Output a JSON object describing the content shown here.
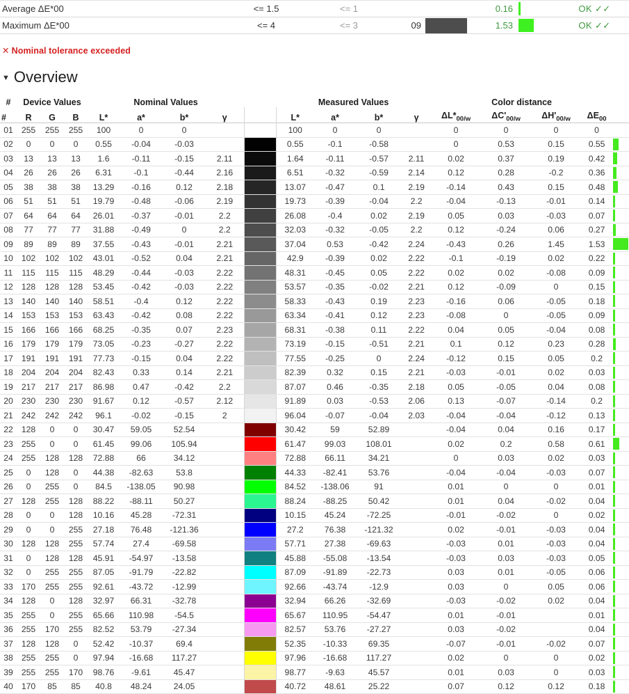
{
  "summary": {
    "rows": [
      {
        "label": "Average ΔE*00",
        "tol1": "<= 1.5",
        "tol2": "<= 1",
        "patch": "",
        "swatch": "",
        "value": "0.16",
        "bar_pct": 4,
        "status": "OK ✓✓"
      },
      {
        "label": "Maximum ΔE*00",
        "tol1": "<= 4",
        "tol2": "<= 3",
        "patch": "09",
        "swatch": "#4d4d4d",
        "value": "1.53",
        "bar_pct": 38,
        "status": "OK ✓✓"
      }
    ]
  },
  "warning": {
    "mark": "✕",
    "text": "Nominal tolerance exceeded",
    "color": "#d42020"
  },
  "overview": {
    "caret": "▼",
    "title": "Overview"
  },
  "table": {
    "groups": [
      {
        "label": "#",
        "span": 1
      },
      {
        "label": "Device Values",
        "span": 3
      },
      {
        "label": "Nominal Values",
        "span": 4
      },
      {
        "label": "",
        "span": 1
      },
      {
        "label": "Measured Values",
        "span": 4
      },
      {
        "label": "Color distance",
        "span": 4
      },
      {
        "label": "",
        "span": 1
      }
    ],
    "columns": [
      "#",
      "R",
      "G",
      "B",
      "L*",
      "a*",
      "b*",
      "γ",
      "",
      "L*",
      "a*",
      "b*",
      "γ",
      "ΔL*00/w",
      "ΔC'00/w",
      "ΔH'00/w",
      "ΔE00",
      ""
    ],
    "colheads": [
      {
        "main": "#",
        "sub": ""
      },
      {
        "main": "R",
        "sub": ""
      },
      {
        "main": "G",
        "sub": ""
      },
      {
        "main": "B",
        "sub": ""
      },
      {
        "main": "L*",
        "sub": ""
      },
      {
        "main": "a*",
        "sub": ""
      },
      {
        "main": "b*",
        "sub": ""
      },
      {
        "main": "γ",
        "sub": ""
      },
      {
        "main": "",
        "sub": ""
      },
      {
        "main": "L*",
        "sub": ""
      },
      {
        "main": "a*",
        "sub": ""
      },
      {
        "main": "b*",
        "sub": ""
      },
      {
        "main": "γ",
        "sub": ""
      },
      {
        "main": "ΔL*",
        "sub": "00/w"
      },
      {
        "main": "ΔC'",
        "sub": "00/w"
      },
      {
        "main": "ΔH'",
        "sub": "00/w"
      },
      {
        "main": "ΔE",
        "sub": "00"
      },
      {
        "main": "",
        "sub": ""
      }
    ],
    "de_bar_max": 1.53,
    "rows": [
      {
        "idx": "01",
        "r": "255",
        "g": "255",
        "b": "255",
        "nL": "100",
        "na": "0",
        "nb": "0",
        "ng": "",
        "sw": "",
        "mL": "100",
        "ma": "0",
        "mb": "0",
        "mg": "",
        "dL": "0",
        "dC": "0",
        "dH": "0",
        "dE": "0",
        "de_num": 0
      },
      {
        "idx": "02",
        "r": "0",
        "g": "0",
        "b": "0",
        "nL": "0.55",
        "na": "-0.04",
        "nb": "-0.03",
        "ng": "",
        "sw": "#020202",
        "mL": "0.55",
        "ma": "-0.1",
        "mb": "-0.58",
        "mg": "",
        "dL": "0",
        "dC": "0.53",
        "dH": "0.15",
        "dE": "0.55",
        "de_num": 0.55
      },
      {
        "idx": "03",
        "r": "13",
        "g": "13",
        "b": "13",
        "nL": "1.6",
        "na": "-0.11",
        "nb": "-0.15",
        "ng": "2.11",
        "sw": "#0b0b0b",
        "mL": "1.64",
        "ma": "-0.11",
        "mb": "-0.57",
        "mg": "2.11",
        "dL": "0.02",
        "dC": "0.37",
        "dH": "0.19",
        "dE": "0.42",
        "de_num": 0.42
      },
      {
        "idx": "04",
        "r": "26",
        "g": "26",
        "b": "26",
        "nL": "6.31",
        "na": "-0.1",
        "nb": "-0.44",
        "ng": "2.16",
        "sw": "#1a1a1a",
        "mL": "6.51",
        "ma": "-0.32",
        "mb": "-0.59",
        "mg": "2.14",
        "dL": "0.12",
        "dC": "0.28",
        "dH": "-0.2",
        "dE": "0.36",
        "de_num": 0.36
      },
      {
        "idx": "05",
        "r": "38",
        "g": "38",
        "b": "38",
        "nL": "13.29",
        "na": "-0.16",
        "nb": "0.12",
        "ng": "2.18",
        "sw": "#262626",
        "mL": "13.07",
        "ma": "-0.47",
        "mb": "0.1",
        "mg": "2.19",
        "dL": "-0.14",
        "dC": "0.43",
        "dH": "0.15",
        "dE": "0.48",
        "de_num": 0.48
      },
      {
        "idx": "06",
        "r": "51",
        "g": "51",
        "b": "51",
        "nL": "19.79",
        "na": "-0.48",
        "nb": "-0.06",
        "ng": "2.19",
        "sw": "#333333",
        "mL": "19.73",
        "ma": "-0.39",
        "mb": "-0.04",
        "mg": "2.2",
        "dL": "-0.04",
        "dC": "-0.13",
        "dH": "-0.01",
        "dE": "0.14",
        "de_num": 0.14
      },
      {
        "idx": "07",
        "r": "64",
        "g": "64",
        "b": "64",
        "nL": "26.01",
        "na": "-0.37",
        "nb": "-0.01",
        "ng": "2.2",
        "sw": "#404040",
        "mL": "26.08",
        "ma": "-0.4",
        "mb": "0.02",
        "mg": "2.19",
        "dL": "0.05",
        "dC": "0.03",
        "dH": "-0.03",
        "dE": "0.07",
        "de_num": 0.07
      },
      {
        "idx": "08",
        "r": "77",
        "g": "77",
        "b": "77",
        "nL": "31.88",
        "na": "-0.49",
        "nb": "0",
        "ng": "2.2",
        "sw": "#4d4d4d",
        "mL": "32.03",
        "ma": "-0.32",
        "mb": "-0.05",
        "mg": "2.2",
        "dL": "0.12",
        "dC": "-0.24",
        "dH": "0.06",
        "dE": "0.27",
        "de_num": 0.27
      },
      {
        "idx": "09",
        "r": "89",
        "g": "89",
        "b": "89",
        "nL": "37.55",
        "na": "-0.43",
        "nb": "-0.01",
        "ng": "2.21",
        "sw": "#595959",
        "mL": "37.04",
        "ma": "0.53",
        "mb": "-0.42",
        "mg": "2.24",
        "dL": "-0.43",
        "dC": "0.26",
        "dH": "1.45",
        "dE": "1.53",
        "de_num": 1.53
      },
      {
        "idx": "10",
        "r": "102",
        "g": "102",
        "b": "102",
        "nL": "43.01",
        "na": "-0.52",
        "nb": "0.04",
        "ng": "2.21",
        "sw": "#666666",
        "mL": "42.9",
        "ma": "-0.39",
        "mb": "0.02",
        "mg": "2.22",
        "dL": "-0.1",
        "dC": "-0.19",
        "dH": "0.02",
        "dE": "0.22",
        "de_num": 0.22
      },
      {
        "idx": "11",
        "r": "115",
        "g": "115",
        "b": "115",
        "nL": "48.29",
        "na": "-0.44",
        "nb": "-0.03",
        "ng": "2.22",
        "sw": "#737373",
        "mL": "48.31",
        "ma": "-0.45",
        "mb": "0.05",
        "mg": "2.22",
        "dL": "0.02",
        "dC": "0.02",
        "dH": "-0.08",
        "dE": "0.09",
        "de_num": 0.09
      },
      {
        "idx": "12",
        "r": "128",
        "g": "128",
        "b": "128",
        "nL": "53.45",
        "na": "-0.42",
        "nb": "-0.03",
        "ng": "2.22",
        "sw": "#808080",
        "mL": "53.57",
        "ma": "-0.35",
        "mb": "-0.02",
        "mg": "2.21",
        "dL": "0.12",
        "dC": "-0.09",
        "dH": "0",
        "dE": "0.15",
        "de_num": 0.15
      },
      {
        "idx": "13",
        "r": "140",
        "g": "140",
        "b": "140",
        "nL": "58.51",
        "na": "-0.4",
        "nb": "0.12",
        "ng": "2.22",
        "sw": "#8c8c8c",
        "mL": "58.33",
        "ma": "-0.43",
        "mb": "0.19",
        "mg": "2.23",
        "dL": "-0.16",
        "dC": "0.06",
        "dH": "-0.05",
        "dE": "0.18",
        "de_num": 0.18
      },
      {
        "idx": "14",
        "r": "153",
        "g": "153",
        "b": "153",
        "nL": "63.43",
        "na": "-0.42",
        "nb": "0.08",
        "ng": "2.22",
        "sw": "#999999",
        "mL": "63.34",
        "ma": "-0.41",
        "mb": "0.12",
        "mg": "2.23",
        "dL": "-0.08",
        "dC": "0",
        "dH": "-0.05",
        "dE": "0.09",
        "de_num": 0.09
      },
      {
        "idx": "15",
        "r": "166",
        "g": "166",
        "b": "166",
        "nL": "68.25",
        "na": "-0.35",
        "nb": "0.07",
        "ng": "2.23",
        "sw": "#a6a6a6",
        "mL": "68.31",
        "ma": "-0.38",
        "mb": "0.11",
        "mg": "2.22",
        "dL": "0.04",
        "dC": "0.05",
        "dH": "-0.04",
        "dE": "0.08",
        "de_num": 0.08
      },
      {
        "idx": "16",
        "r": "179",
        "g": "179",
        "b": "179",
        "nL": "73.05",
        "na": "-0.23",
        "nb": "-0.27",
        "ng": "2.22",
        "sw": "#b3b3b3",
        "mL": "73.19",
        "ma": "-0.15",
        "mb": "-0.51",
        "mg": "2.21",
        "dL": "0.1",
        "dC": "0.12",
        "dH": "0.23",
        "dE": "0.28",
        "de_num": 0.28
      },
      {
        "idx": "17",
        "r": "191",
        "g": "191",
        "b": "191",
        "nL": "77.73",
        "na": "-0.15",
        "nb": "0.04",
        "ng": "2.22",
        "sw": "#bfbfbf",
        "mL": "77.55",
        "ma": "-0.25",
        "mb": "0",
        "mg": "2.24",
        "dL": "-0.12",
        "dC": "0.15",
        "dH": "0.05",
        "dE": "0.2",
        "de_num": 0.2
      },
      {
        "idx": "18",
        "r": "204",
        "g": "204",
        "b": "204",
        "nL": "82.43",
        "na": "0.33",
        "nb": "0.14",
        "ng": "2.21",
        "sw": "#cccccc",
        "mL": "82.39",
        "ma": "0.32",
        "mb": "0.15",
        "mg": "2.21",
        "dL": "-0.03",
        "dC": "-0.01",
        "dH": "0.02",
        "dE": "0.03",
        "de_num": 0.03
      },
      {
        "idx": "19",
        "r": "217",
        "g": "217",
        "b": "217",
        "nL": "86.98",
        "na": "0.47",
        "nb": "-0.42",
        "ng": "2.2",
        "sw": "#d9d9d9",
        "mL": "87.07",
        "ma": "0.46",
        "mb": "-0.35",
        "mg": "2.18",
        "dL": "0.05",
        "dC": "-0.05",
        "dH": "0.04",
        "dE": "0.08",
        "de_num": 0.08
      },
      {
        "idx": "20",
        "r": "230",
        "g": "230",
        "b": "230",
        "nL": "91.67",
        "na": "0.12",
        "nb": "-0.57",
        "ng": "2.12",
        "sw": "#e6e6e6",
        "mL": "91.89",
        "ma": "0.03",
        "mb": "-0.53",
        "mg": "2.06",
        "dL": "0.13",
        "dC": "-0.07",
        "dH": "-0.14",
        "dE": "0.2",
        "de_num": 0.2
      },
      {
        "idx": "21",
        "r": "242",
        "g": "242",
        "b": "242",
        "nL": "96.1",
        "na": "-0.02",
        "nb": "-0.15",
        "ng": "2",
        "sw": "#f2f2f2",
        "mL": "96.04",
        "ma": "-0.07",
        "mb": "-0.04",
        "mg": "2.03",
        "dL": "-0.04",
        "dC": "-0.04",
        "dH": "-0.12",
        "dE": "0.13",
        "de_num": 0.13
      },
      {
        "idx": "22",
        "r": "128",
        "g": "0",
        "b": "0",
        "nL": "30.47",
        "na": "59.05",
        "nb": "52.54",
        "ng": "",
        "sw": "#800000",
        "mL": "30.42",
        "ma": "59",
        "mb": "52.89",
        "mg": "",
        "dL": "-0.04",
        "dC": "0.04",
        "dH": "0.16",
        "dE": "0.17",
        "de_num": 0.17
      },
      {
        "idx": "23",
        "r": "255",
        "g": "0",
        "b": "0",
        "nL": "61.45",
        "na": "99.06",
        "nb": "105.94",
        "ng": "",
        "sw": "#ff0000",
        "mL": "61.47",
        "ma": "99.03",
        "mb": "108.01",
        "mg": "",
        "dL": "0.02",
        "dC": "0.2",
        "dH": "0.58",
        "dE": "0.61",
        "de_num": 0.61
      },
      {
        "idx": "24",
        "r": "255",
        "g": "128",
        "b": "128",
        "nL": "72.88",
        "na": "66",
        "nb": "34.12",
        "ng": "",
        "sw": "#ff8080",
        "mL": "72.88",
        "ma": "66.11",
        "mb": "34.21",
        "mg": "",
        "dL": "0",
        "dC": "0.03",
        "dH": "0.02",
        "dE": "0.03",
        "de_num": 0.03
      },
      {
        "idx": "25",
        "r": "0",
        "g": "128",
        "b": "0",
        "nL": "44.38",
        "na": "-82.63",
        "nb": "53.8",
        "ng": "",
        "sw": "#008000",
        "mL": "44.33",
        "ma": "-82.41",
        "mb": "53.76",
        "mg": "",
        "dL": "-0.04",
        "dC": "-0.04",
        "dH": "-0.03",
        "dE": "0.07",
        "de_num": 0.07
      },
      {
        "idx": "26",
        "r": "0",
        "g": "255",
        "b": "0",
        "nL": "84.5",
        "na": "-138.05",
        "nb": "90.98",
        "ng": "",
        "sw": "#00ff00",
        "mL": "84.52",
        "ma": "-138.06",
        "mb": "91",
        "mg": "",
        "dL": "0.01",
        "dC": "0",
        "dH": "0",
        "dE": "0.01",
        "de_num": 0.01
      },
      {
        "idx": "27",
        "r": "128",
        "g": "255",
        "b": "128",
        "nL": "88.22",
        "na": "-88.11",
        "nb": "50.27",
        "ng": "",
        "sw": "#2bf590",
        "mL": "88.24",
        "ma": "-88.25",
        "mb": "50.42",
        "mg": "",
        "dL": "0.01",
        "dC": "0.04",
        "dH": "-0.02",
        "dE": "0.04",
        "de_num": 0.04
      },
      {
        "idx": "28",
        "r": "0",
        "g": "0",
        "b": "128",
        "nL": "10.16",
        "na": "45.28",
        "nb": "-72.31",
        "ng": "",
        "sw": "#000080",
        "mL": "10.15",
        "ma": "45.24",
        "mb": "-72.25",
        "mg": "",
        "dL": "-0.01",
        "dC": "-0.02",
        "dH": "0",
        "dE": "0.02",
        "de_num": 0.02
      },
      {
        "idx": "29",
        "r": "0",
        "g": "0",
        "b": "255",
        "nL": "27.18",
        "na": "76.48",
        "nb": "-121.36",
        "ng": "",
        "sw": "#0000ff",
        "mL": "27.2",
        "ma": "76.38",
        "mb": "-121.32",
        "mg": "",
        "dL": "0.02",
        "dC": "-0.01",
        "dH": "-0.03",
        "dE": "0.04",
        "de_num": 0.04
      },
      {
        "idx": "30",
        "r": "128",
        "g": "128",
        "b": "255",
        "nL": "57.74",
        "na": "27.4",
        "nb": "-69.58",
        "ng": "",
        "sw": "#7b7bf5",
        "mL": "57.71",
        "ma": "27.38",
        "mb": "-69.63",
        "mg": "",
        "dL": "-0.03",
        "dC": "0.01",
        "dH": "-0.03",
        "dE": "0.04",
        "de_num": 0.04
      },
      {
        "idx": "31",
        "r": "0",
        "g": "128",
        "b": "128",
        "nL": "45.91",
        "na": "-54.97",
        "nb": "-13.58",
        "ng": "",
        "sw": "#118080",
        "mL": "45.88",
        "ma": "-55.08",
        "mb": "-13.54",
        "mg": "",
        "dL": "-0.03",
        "dC": "0.03",
        "dH": "-0.03",
        "dE": "0.05",
        "de_num": 0.05
      },
      {
        "idx": "32",
        "r": "0",
        "g": "255",
        "b": "255",
        "nL": "87.05",
        "na": "-91.79",
        "nb": "-22.82",
        "ng": "",
        "sw": "#00ffff",
        "mL": "87.09",
        "ma": "-91.89",
        "mb": "-22.73",
        "mg": "",
        "dL": "0.03",
        "dC": "0.01",
        "dH": "-0.05",
        "dE": "0.06",
        "de_num": 0.06
      },
      {
        "idx": "33",
        "r": "170",
        "g": "255",
        "b": "255",
        "nL": "92.61",
        "na": "-43.72",
        "nb": "-12.99",
        "ng": "",
        "sw": "#6ef5ff",
        "mL": "92.66",
        "ma": "-43.74",
        "mb": "-12.9",
        "mg": "",
        "dL": "0.03",
        "dC": "0",
        "dH": "0.05",
        "dE": "0.06",
        "de_num": 0.06
      },
      {
        "idx": "34",
        "r": "128",
        "g": "0",
        "b": "128",
        "nL": "32.97",
        "na": "66.31",
        "nb": "-32.78",
        "ng": "",
        "sw": "#8b0090",
        "mL": "32.94",
        "ma": "66.26",
        "mb": "-32.69",
        "mg": "",
        "dL": "-0.03",
        "dC": "-0.02",
        "dH": "0.02",
        "dE": "0.04",
        "de_num": 0.04
      },
      {
        "idx": "35",
        "r": "255",
        "g": "0",
        "b": "255",
        "nL": "65.66",
        "na": "110.98",
        "nb": "-54.5",
        "ng": "",
        "sw": "#ff00ff",
        "mL": "65.67",
        "ma": "110.95",
        "mb": "-54.47",
        "mg": "",
        "dL": "0.01",
        "dC": "-0.01",
        "dH": "",
        "dE": "0.01",
        "de_num": 0.01
      },
      {
        "idx": "36",
        "r": "255",
        "g": "170",
        "b": "255",
        "nL": "82.52",
        "na": "53.79",
        "nb": "-27.34",
        "ng": "",
        "sw": "#f799f0",
        "mL": "82.57",
        "ma": "53.76",
        "mb": "-27.27",
        "mg": "",
        "dL": "0.03",
        "dC": "-0.02",
        "dH": "",
        "dE": "0.04",
        "de_num": 0.04
      },
      {
        "idx": "37",
        "r": "128",
        "g": "128",
        "b": "0",
        "nL": "52.42",
        "na": "-10.37",
        "nb": "69.4",
        "ng": "",
        "sw": "#807c05",
        "mL": "52.35",
        "ma": "-10.33",
        "mb": "69.35",
        "mg": "",
        "dL": "-0.07",
        "dC": "-0.01",
        "dH": "-0.02",
        "dE": "0.07",
        "de_num": 0.07
      },
      {
        "idx": "38",
        "r": "255",
        "g": "255",
        "b": "0",
        "nL": "97.94",
        "na": "-16.68",
        "nb": "117.27",
        "ng": "",
        "sw": "#ffff00",
        "mL": "97.96",
        "ma": "-16.68",
        "mb": "117.27",
        "mg": "",
        "dL": "0.02",
        "dC": "0",
        "dH": "0",
        "dE": "0.02",
        "de_num": 0.02
      },
      {
        "idx": "39",
        "r": "255",
        "g": "255",
        "b": "170",
        "nL": "98.76",
        "na": "-9.61",
        "nb": "45.47",
        "ng": "",
        "sw": "#fbf3a6",
        "mL": "98.77",
        "ma": "-9.63",
        "mb": "45.57",
        "mg": "",
        "dL": "0.01",
        "dC": "0.03",
        "dH": "0",
        "dE": "0.03",
        "de_num": 0.03
      },
      {
        "idx": "40",
        "r": "170",
        "g": "85",
        "b": "85",
        "nL": "40.8",
        "na": "48.24",
        "nb": "24.05",
        "ng": "",
        "sw": "#c14a4a",
        "mL": "40.72",
        "ma": "48.61",
        "mb": "25.22",
        "mg": "",
        "dL": "0.07",
        "dC": "0.12",
        "dH": "0.12",
        "dE": "0.18",
        "de_num": 0.18
      }
    ]
  }
}
